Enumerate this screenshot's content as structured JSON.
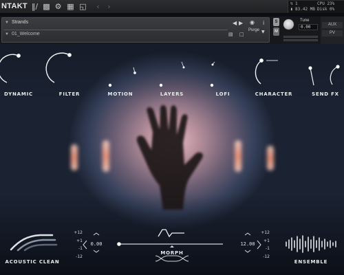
{
  "topbar": {
    "brand": "NTAKT",
    "stats": {
      "midi": "1",
      "mem": "83.42 MB",
      "cpu": "CPU 23%",
      "disk": "Disk 0%"
    }
  },
  "header": {
    "instrument_name": "Strands",
    "snapshot_name": "01_Welcome",
    "purge_label": "Purge",
    "s_label": "S",
    "m_label": "M",
    "tune_label": "Tune",
    "tune_value": "0.00",
    "aux_label": "AUX",
    "pv_label": "PV"
  },
  "controls": [
    {
      "label": "DYNAMIC"
    },
    {
      "label": "FILTER"
    },
    {
      "label": "MOTION"
    },
    {
      "label": "LAYERS"
    },
    {
      "label": "LOFI"
    },
    {
      "label": "CHARACTER"
    },
    {
      "label": "SEND FX"
    }
  ],
  "bottom": {
    "left_label": "ACOUSTIC CLEAN",
    "morph_label": "MORPH",
    "right_label": "ENSEMBLE",
    "left_value": "0.00",
    "right_value": "12.00",
    "steps": [
      "+12",
      "+1",
      "-1",
      "-12"
    ]
  },
  "colors": {
    "text": "#e9ecef",
    "panel": "#2b2d30",
    "glow": "#ff9a7a"
  }
}
